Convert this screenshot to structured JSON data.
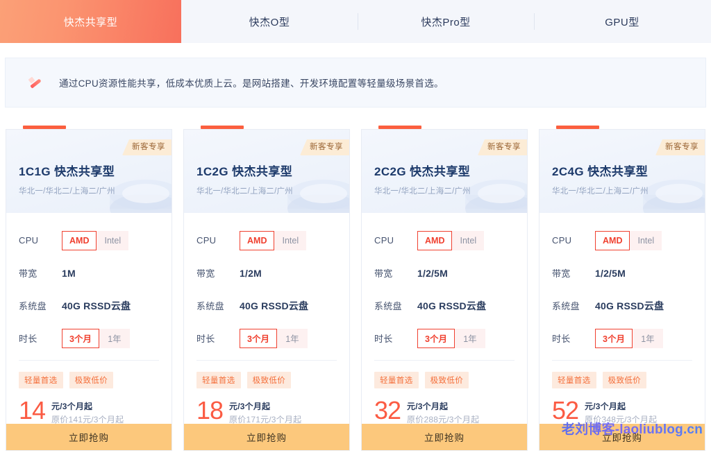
{
  "tabs": [
    {
      "label": "快杰共享型",
      "active": true
    },
    {
      "label": "快杰O型",
      "active": false
    },
    {
      "label": "快杰Pro型",
      "active": false
    },
    {
      "label": "GPU型",
      "active": false
    }
  ],
  "notice": {
    "icon": "ribbon-icon",
    "text": "通过CPU资源性能共享，低成本优质上云。是网站搭建、开发环境配置等轻量级场景首选。"
  },
  "cards": [
    {
      "badge": "新客专享",
      "title": "1C1G 快杰共享型",
      "regions": "华北一/华北二/上海二/广州",
      "specs": [
        {
          "label": "CPU",
          "type": "options",
          "options": [
            "AMD",
            "Intel"
          ],
          "selected": "AMD"
        },
        {
          "label": "带宽",
          "type": "text",
          "value": "1M"
        },
        {
          "label": "系统盘",
          "type": "text",
          "value": "40G RSSD云盘"
        },
        {
          "label": "时长",
          "type": "options",
          "options": [
            "3个月",
            "1年"
          ],
          "selected": "3个月"
        }
      ],
      "tags": [
        "轻量首选",
        "极致低价"
      ],
      "price": "14",
      "price_unit": "元/3个月起",
      "price_original": "原价141元/3个月起",
      "buy_label": "立即抢购"
    },
    {
      "badge": "新客专享",
      "title": "1C2G 快杰共享型",
      "regions": "华北一/华北二/上海二/广州",
      "specs": [
        {
          "label": "CPU",
          "type": "options",
          "options": [
            "AMD",
            "Intel"
          ],
          "selected": "AMD"
        },
        {
          "label": "带宽",
          "type": "text",
          "value": "1/2M"
        },
        {
          "label": "系统盘",
          "type": "text",
          "value": "40G RSSD云盘"
        },
        {
          "label": "时长",
          "type": "options",
          "options": [
            "3个月",
            "1年"
          ],
          "selected": "3个月"
        }
      ],
      "tags": [
        "轻量首选",
        "极致低价"
      ],
      "price": "18",
      "price_unit": "元/3个月起",
      "price_original": "原价171元/3个月起",
      "buy_label": "立即抢购"
    },
    {
      "badge": "新客专享",
      "title": "2C2G 快杰共享型",
      "regions": "华北一/华北二/上海二/广州",
      "specs": [
        {
          "label": "CPU",
          "type": "options",
          "options": [
            "AMD",
            "Intel"
          ],
          "selected": "AMD"
        },
        {
          "label": "带宽",
          "type": "text",
          "value": "1/2/5M"
        },
        {
          "label": "系统盘",
          "type": "text",
          "value": "40G RSSD云盘"
        },
        {
          "label": "时长",
          "type": "options",
          "options": [
            "3个月",
            "1年"
          ],
          "selected": "3个月"
        }
      ],
      "tags": [
        "轻量首选",
        "极致低价"
      ],
      "price": "32",
      "price_unit": "元/3个月起",
      "price_original": "原价288元/3个月起",
      "buy_label": "立即抢购"
    },
    {
      "badge": "新客专享",
      "title": "2C4G 快杰共享型",
      "regions": "华北一/华北二/上海二/广州",
      "specs": [
        {
          "label": "CPU",
          "type": "options",
          "options": [
            "AMD",
            "Intel"
          ],
          "selected": "AMD"
        },
        {
          "label": "带宽",
          "type": "text",
          "value": "1/2/5M"
        },
        {
          "label": "系统盘",
          "type": "text",
          "value": "40G RSSD云盘"
        },
        {
          "label": "时长",
          "type": "options",
          "options": [
            "3个月",
            "1年"
          ],
          "selected": "3个月"
        }
      ],
      "tags": [
        "轻量首选",
        "极致低价"
      ],
      "price": "52",
      "price_unit": "元/3个月起",
      "price_original": "原价348元/3个月起",
      "buy_label": "立即抢购"
    }
  ],
  "watermark": "老刘博客-laoliublog.cn",
  "colors": {
    "accent_orange": "#fb5f3f",
    "tab_active_from": "#fba077",
    "tab_active_to": "#f8705c",
    "price_red": "#fb5b43",
    "buy_button": "#fcc87c",
    "badge_bg": "#fcecd6",
    "tag_bg": "#fdeade",
    "tag_text": "#f4703c",
    "selected_border": "#f0402f"
  }
}
